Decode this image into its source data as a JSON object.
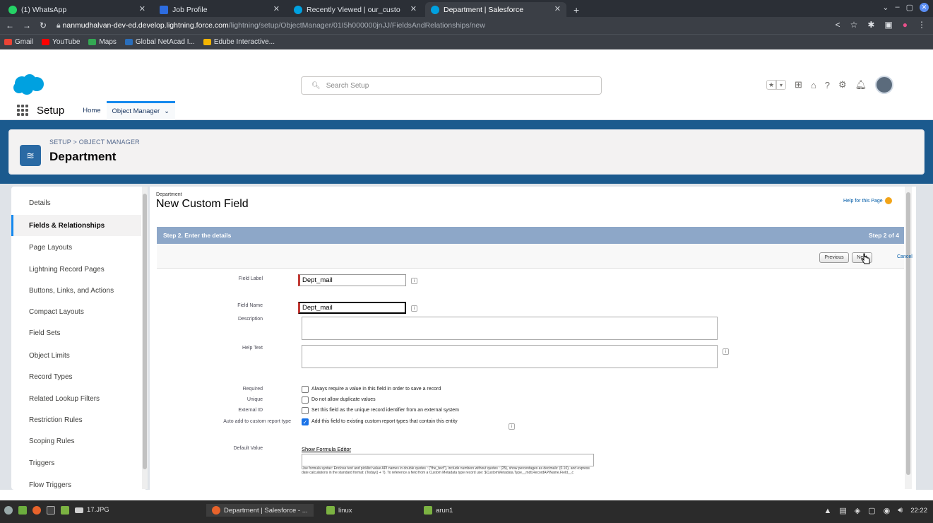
{
  "browser": {
    "tabs": [
      {
        "title": "(1) WhatsApp",
        "color": "#25d366"
      },
      {
        "title": "Job Profile",
        "color": "#2d6cdf"
      },
      {
        "title": "Recently Viewed | our_custo",
        "color": "#00a1e0"
      },
      {
        "title": "Department | Salesforce",
        "color": "#00a1e0"
      }
    ],
    "new_tab": "+",
    "url_host": "nanmudhalvan-dev-ed.develop.lightning.force.com",
    "url_path": "/lightning/setup/ObjectManager/01I5h000000jnJJ/FieldsAndRelationships/new",
    "bookmarks": [
      {
        "label": "Gmail",
        "color": "#ea4335"
      },
      {
        "label": "YouTube",
        "color": "#ff0000"
      },
      {
        "label": "Maps",
        "color": "#34a853"
      },
      {
        "label": "Global NetAcad I...",
        "color": "#2a6ebb"
      },
      {
        "label": "Edube Interactive...",
        "color": "#f4b400"
      }
    ]
  },
  "sf": {
    "search_placeholder": "Search Setup",
    "app_name": "Setup",
    "nav_tabs": [
      "Home",
      "Object Manager"
    ],
    "breadcrumb": "SETUP > OBJECT MANAGER",
    "object_title": "Department",
    "sidebar": [
      "Details",
      "Fields & Relationships",
      "Page Layouts",
      "Lightning Record Pages",
      "Buttons, Links, and Actions",
      "Compact Layouts",
      "Field Sets",
      "Object Limits",
      "Record Types",
      "Related Lookup Filters",
      "Restriction Rules",
      "Scoping Rules",
      "Triggers",
      "Flow Triggers"
    ],
    "active_sidebar": "Fields & Relationships"
  },
  "form": {
    "object_small": "Department",
    "title": "New Custom Field",
    "help_link": "Help for this Page",
    "step_title": "Step 2. Enter the details",
    "step_count": "Step 2 of 4",
    "previous": "Previous",
    "next": "Next",
    "cancel": "Cancel",
    "field_label_lbl": "Field Label",
    "field_label_val": "Dept_mail",
    "field_name_lbl": "Field Name",
    "field_name_val": "Dept_mail",
    "description_lbl": "Description",
    "help_text_lbl": "Help Text",
    "required_lbl": "Required",
    "required_txt": "Always require a value in this field in order to save a record",
    "unique_lbl": "Unique",
    "unique_txt": "Do not allow duplicate values",
    "external_lbl": "External ID",
    "external_txt": "Set this field as the unique record identifier from an external system",
    "autoadd_lbl": "Auto add to custom report type",
    "autoadd_txt": "Add this field to existing custom report types that contain this entity",
    "default_lbl": "Default Value",
    "formula_link": "Show Formula Editor",
    "default_help": "Use formula syntax: Enclose text and picklist value API names in double quotes : (\"the_text\"), include numbers without quotes : (25), show percentages as decimals: (0.10), and express date calculations in the standard format: (Today() + 7). To reference a field from a Custom Metadata type record use: $CustomMetadata.Type__mdt.RecordAPIName.Field__c"
  },
  "taskbar": {
    "items": [
      "17.JPG",
      "Department | Salesforce - ...",
      "linux",
      "arun1"
    ],
    "clock": "22:22"
  }
}
